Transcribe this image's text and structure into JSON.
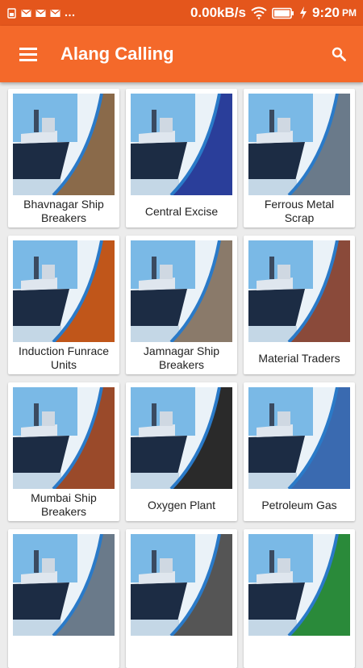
{
  "status_bar": {
    "network_speed": "0.00kB/s",
    "time": "9:20",
    "ampm": "PM"
  },
  "app_bar": {
    "title": "Alang Calling",
    "menu_icon": "hamburger-menu-icon",
    "search_icon": "search-icon"
  },
  "colors": {
    "status_bar": "#e4561c",
    "app_bar": "#f4692a",
    "background": "#ececec",
    "ship_hull": "#1c2c44",
    "sky": "#7ab9e6"
  },
  "categories": [
    {
      "label": "Bhavnagar Ship Breakers",
      "image": "ship-breaking-hull-image",
      "photo_tone": "#8a6a4a"
    },
    {
      "label": "Central Excise",
      "image": "customs-emblem-image",
      "photo_tone": "#2a3e9a"
    },
    {
      "label": "Ferrous Metal Scrap",
      "image": "scrap-worker-image",
      "photo_tone": "#6a7a8a"
    },
    {
      "label": "Induction Funrace Units",
      "image": "molten-metal-furnace-image",
      "photo_tone": "#c0561a"
    },
    {
      "label": "Jamnagar Ship Breakers",
      "image": "beached-ship-image",
      "photo_tone": "#8a7a6a"
    },
    {
      "label": "Material Traders",
      "image": "ship-wheel-image",
      "photo_tone": "#8a4a3a"
    },
    {
      "label": "Mumbai Ship Breakers",
      "image": "rusty-hull-image",
      "photo_tone": "#9a4a2a"
    },
    {
      "label": "Oxygen Plant",
      "image": "gas-cylinders-image",
      "photo_tone": "#2a2a2a"
    },
    {
      "label": "Petroleum Gas",
      "image": "lpg-cylinders-image",
      "photo_tone": "#3a6ab0"
    },
    {
      "label": "",
      "image": "scrap-worker-image",
      "photo_tone": "#6a7a8a"
    },
    {
      "label": "",
      "image": "steel-rebar-image",
      "photo_tone": "#555555"
    },
    {
      "label": "",
      "image": "service-tax-logo-image",
      "photo_tone": "#2a8a3a"
    }
  ]
}
